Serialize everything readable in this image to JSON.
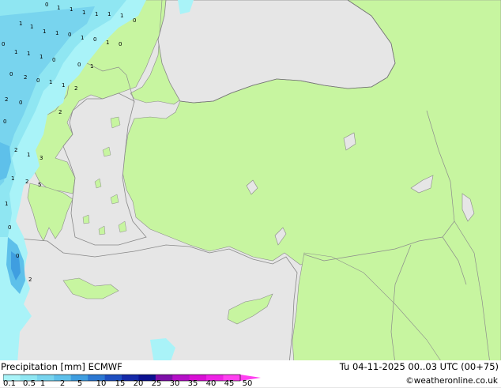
{
  "header": {
    "title_left": "Precipitation [mm]  ECMWF",
    "title_right": "Tu 04-11-2025 00..03 UTC (00+75)",
    "credit": "©weatheronline.co.uk"
  },
  "legend": {
    "ticks": [
      "0.1",
      "0.5",
      "1",
      "2",
      "5",
      "10",
      "15",
      "20",
      "25",
      "30",
      "35",
      "40",
      "45",
      "50"
    ],
    "colors": [
      "#a9f3f8",
      "#8fe6f2",
      "#78d4ee",
      "#5ec0ea",
      "#3f9ee0",
      "#2c78d2",
      "#1e4fc0",
      "#1529a8",
      "#0c1190",
      "#7d0fa8",
      "#b50fc8",
      "#d80fd5",
      "#ee22e6",
      "#ff40f0"
    ]
  },
  "colors": {
    "land": "#c7f5a0",
    "sea": "#e6e6e6",
    "border": "#8c8c8c",
    "coast": "#888888"
  },
  "map": {
    "precip_values": [
      "0",
      "1",
      "1",
      "1",
      "1",
      "1",
      "1",
      "0",
      "1",
      "1",
      "1",
      "1",
      "0",
      "1",
      "0",
      "1",
      "0",
      "0",
      "1",
      "1",
      "1",
      "0",
      "0",
      "1",
      "0",
      "2",
      "0",
      "1",
      "1",
      "2",
      "2",
      "0",
      "2",
      "0",
      "2",
      "1",
      "3",
      "1",
      "2",
      "5",
      "1",
      "0",
      "0",
      "2"
    ]
  }
}
